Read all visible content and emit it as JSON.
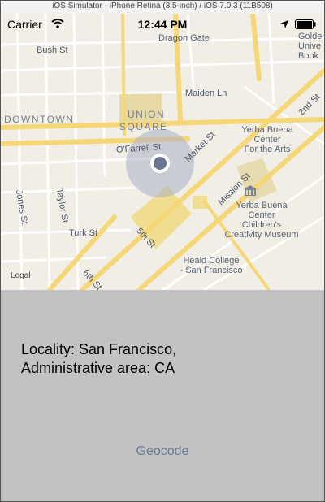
{
  "window": {
    "title": "iOS Simulator - iPhone Retina (3.5-inch) / iOS 7.0.3 (11B508)"
  },
  "status_bar": {
    "carrier": "Carrier",
    "time": "12:44 PM"
  },
  "map": {
    "streets": [
      {
        "id": "bush",
        "text": "Bush St"
      },
      {
        "id": "maiden",
        "text": "Maiden Ln"
      },
      {
        "id": "ofarrell",
        "text": "O'Farrell St"
      },
      {
        "id": "market",
        "text": "Market St"
      },
      {
        "id": "mission",
        "text": "Mission St"
      },
      {
        "id": "jones",
        "text": "Jones St"
      },
      {
        "id": "taylor",
        "text": "Taylor St"
      },
      {
        "id": "turk",
        "text": "Turk St"
      },
      {
        "id": "fifth",
        "text": "5th St"
      },
      {
        "id": "sixth",
        "text": "6th St"
      },
      {
        "id": "second",
        "text": "2nd St"
      }
    ],
    "places": {
      "dragon_gate": "Dragon Gate",
      "downtown": "DOWNTOWN",
      "union_square_1": "UNION",
      "union_square_2": "SQUARE",
      "ybca_1": "Yerba Buena",
      "ybca_2": "Center",
      "ybca_3": "For the Arts",
      "children_1": "Yerba Buena",
      "children_2": "Center",
      "children_3": "Children's",
      "children_4": "Creativity Museum",
      "heald_1": "Heald College",
      "heald_2": "- San Francisco",
      "golden_1": "Golde",
      "golden_2": "Unive",
      "golden_3": "Book"
    },
    "legal": "Legal"
  },
  "result": {
    "line1": "Locality: San Francisco,",
    "line2": "Administrative area: CA"
  },
  "actions": {
    "geocode": "Geocode"
  },
  "colors": {
    "map_bg": "#f1eee6",
    "major_road": "#f6d778",
    "panel_bg": "#c2c2c2",
    "button_text": "#6b7a96"
  }
}
